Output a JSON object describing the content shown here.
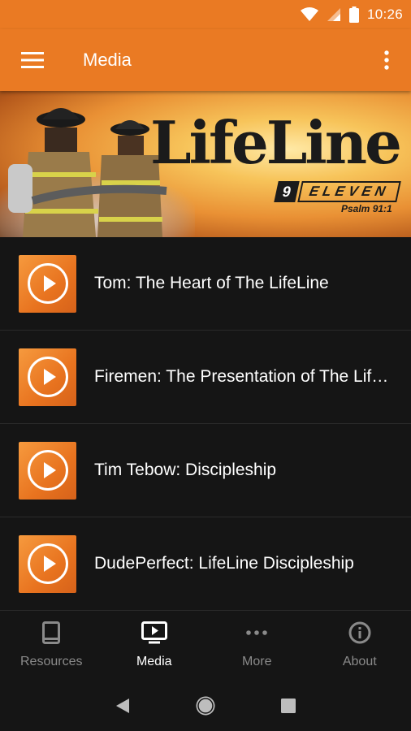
{
  "status_bar": {
    "time": "10:26",
    "icons": [
      "wifi-icon",
      "signal-icon",
      "battery-icon"
    ]
  },
  "app_bar": {
    "title": "Media",
    "menu_icon": "hamburger-menu-icon",
    "overflow_icon": "more-vert-icon"
  },
  "banner": {
    "logo_text": "LifeLine",
    "badge_number": "9",
    "badge_word": "ELEVEN",
    "verse": "Psalm 91:1"
  },
  "media_items": [
    {
      "title": "Tom: The Heart of The LifeLine",
      "icon": "play-icon"
    },
    {
      "title": "Firemen: The Presentation of The LifeLine",
      "icon": "play-icon"
    },
    {
      "title": "Tim Tebow: Discipleship",
      "icon": "play-icon"
    },
    {
      "title": "DudePerfect: LifeLine Discipleship",
      "icon": "play-icon"
    }
  ],
  "bottom_nav": [
    {
      "label": "Resources",
      "icon": "book-icon",
      "active": false
    },
    {
      "label": "Media",
      "icon": "tv-play-icon",
      "active": true
    },
    {
      "label": "More",
      "icon": "more-horiz-icon",
      "active": false
    },
    {
      "label": "About",
      "icon": "info-icon",
      "active": false
    }
  ],
  "colors": {
    "accent": "#ea7a23",
    "background": "#151515",
    "active_nav": "#ffffff",
    "inactive_nav": "#8a8a8a"
  }
}
